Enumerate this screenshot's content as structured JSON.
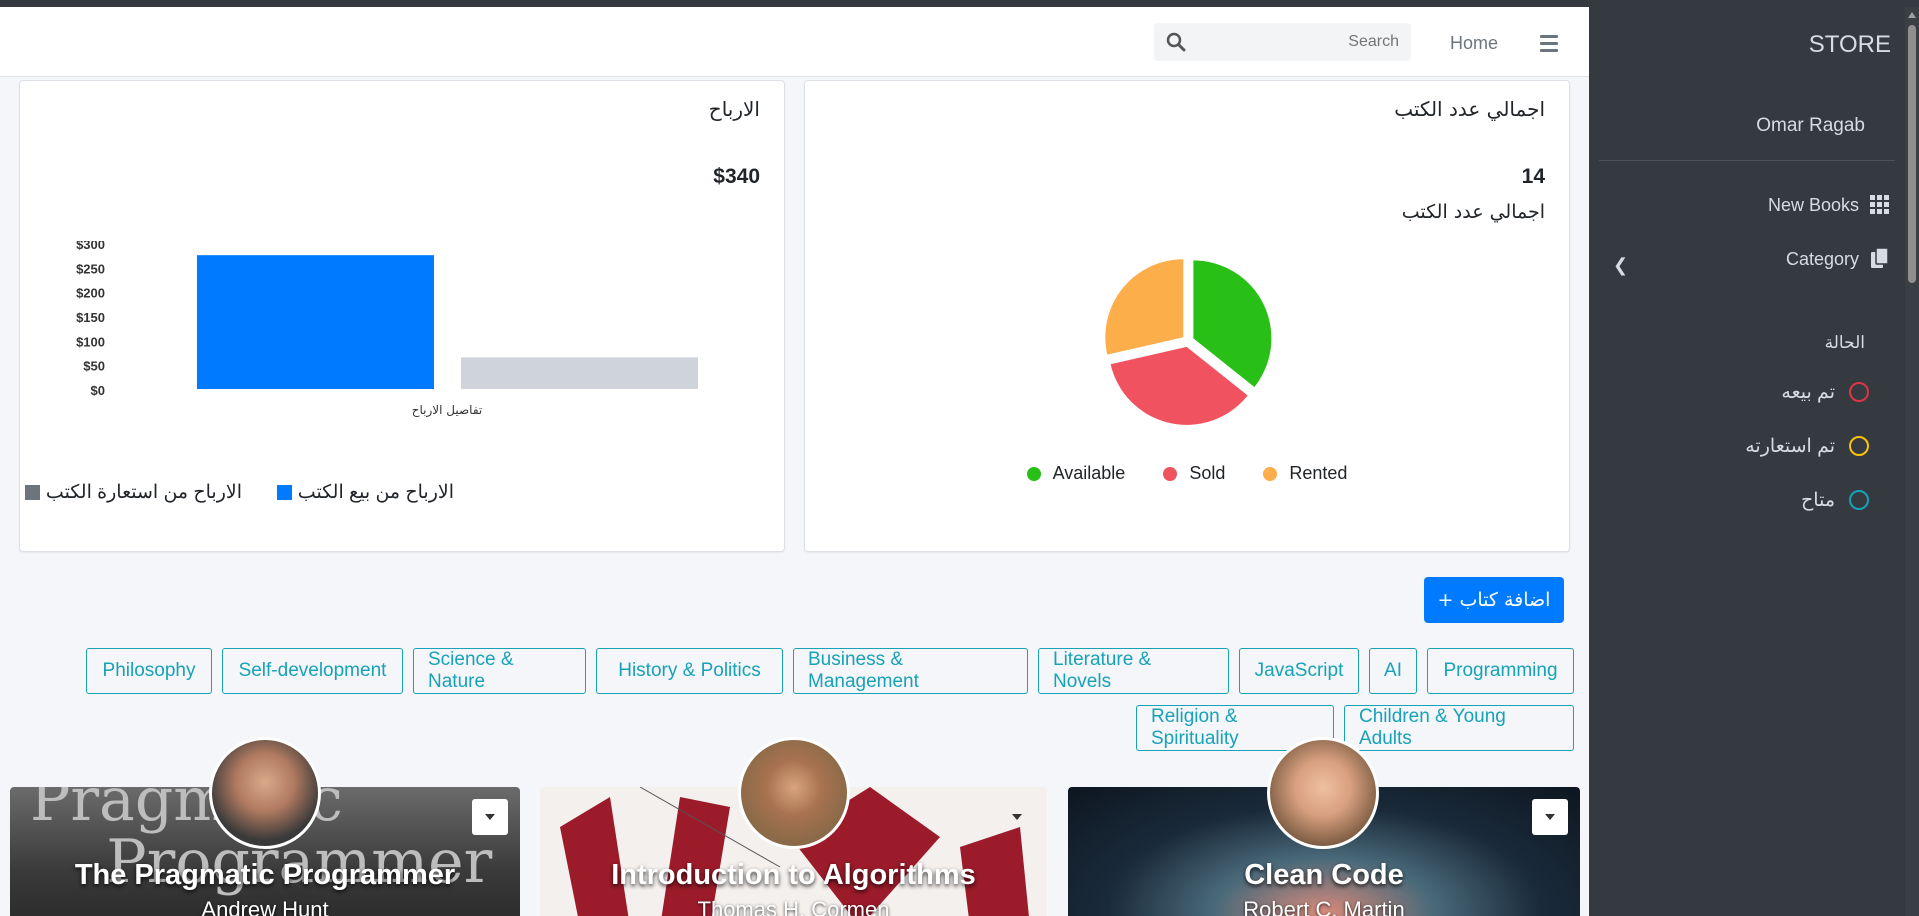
{
  "sidebar": {
    "brand": "STORE",
    "user": "Omar Ragab",
    "nav": [
      {
        "label": "New Books",
        "icon": "grid-icon"
      },
      {
        "label": "Category",
        "icon": "copy-icon"
      }
    ],
    "status_header": "الحالة",
    "statuses": [
      {
        "label": "تم بيعه",
        "color": "#dc3545"
      },
      {
        "label": "تم استعارته",
        "color": "#ffc107"
      },
      {
        "label": "متاح",
        "color": "#17a2b8"
      }
    ]
  },
  "topbar": {
    "search_placeholder": "Search",
    "home": "Home"
  },
  "profits_card": {
    "title": "الارباح",
    "value": "$340",
    "legend": [
      {
        "label": "الارباح من بيع الكتب",
        "color": "#007bff"
      },
      {
        "label": "الارباح من استعارة الكتب",
        "color": "#6c757d"
      }
    ]
  },
  "books_card": {
    "title": "اجمالي عدد الكتب",
    "value": "14",
    "subtitle": "اجمالي عدد الكتب",
    "legend": [
      {
        "label": "Available",
        "color": "#28c017"
      },
      {
        "label": "Sold",
        "color": "#f0525f"
      },
      {
        "label": "Rented",
        "color": "#fbae4a"
      }
    ]
  },
  "chart_data": [
    {
      "type": "bar",
      "categories": [
        "تفاصيل الارباح"
      ],
      "series": [
        {
          "name": "الارباح من بيع الكتب",
          "values": [
            275
          ],
          "color": "#007bff"
        },
        {
          "name": "الارباح من استعارة الكتب",
          "values": [
            65
          ],
          "color": "#ced4da"
        }
      ],
      "yticks": [
        "$0",
        "$50",
        "$100",
        "$150",
        "$200",
        "$250",
        "$300"
      ],
      "ylim": [
        0,
        300
      ],
      "xlabel": "تفاصيل الارباح"
    },
    {
      "type": "pie",
      "labels": [
        "Available",
        "Sold",
        "Rented"
      ],
      "values": [
        5,
        5,
        4
      ],
      "colors": [
        "#28c017",
        "#f0525f",
        "#fbae4a"
      ],
      "legend": "bottom"
    }
  ],
  "actions": {
    "add_book": "+ اضافة كتاب"
  },
  "categories_row1": [
    "Programming",
    "AI",
    "JavaScript",
    "Literature & Novels",
    "Business & Management",
    "History & Politics",
    "Science & Nature",
    "Self-development",
    "Philosophy"
  ],
  "categories_row2": [
    "Children & Young Adults",
    "Religion & Spirituality"
  ],
  "books": [
    {
      "title": "The Pragmatic Programmer",
      "author": "Andrew Hunt"
    },
    {
      "title": "Introduction to Algorithms",
      "author": "Thomas H. Cormen"
    },
    {
      "title": "Clean Code",
      "author": "Robert C. Martin"
    }
  ]
}
